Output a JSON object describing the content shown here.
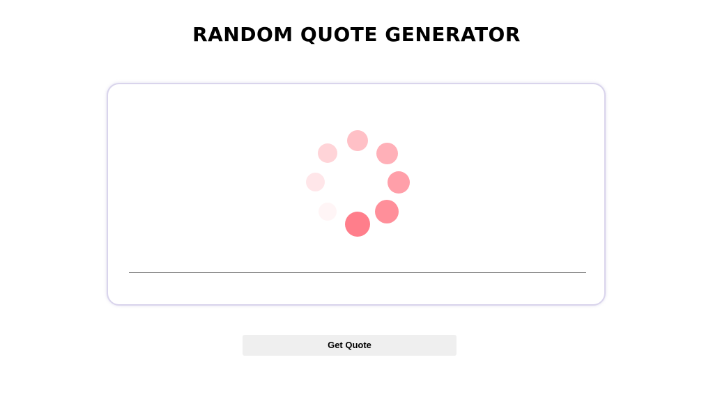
{
  "header": {
    "title": "RANDOM QUOTE GENERATOR"
  },
  "quote_card": {
    "loading": true,
    "spinner": {
      "color": "#ff5a6a",
      "dot_count": 8
    }
  },
  "actions": {
    "get_quote_label": "Get Quote"
  }
}
